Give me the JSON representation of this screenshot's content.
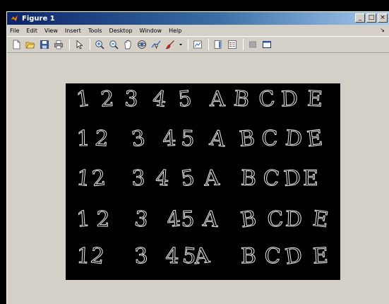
{
  "window": {
    "title": "Figure 1",
    "controls": {
      "minimize": "_",
      "maximize": "□",
      "close": "×"
    }
  },
  "menu": {
    "items": [
      "File",
      "Edit",
      "View",
      "Insert",
      "Tools",
      "Desktop",
      "Window",
      "Help"
    ],
    "end_arrow": "↘"
  },
  "toolbar": {
    "buttons": [
      "new-figure-icon",
      "open-file-icon",
      "save-icon",
      "print-icon",
      "pointer-icon",
      "zoom-in-icon",
      "zoom-out-icon",
      "pan-icon",
      "rotate-3d-icon",
      "data-cursor-icon",
      "brush-icon",
      "link-plot-icon",
      "colorbar-icon",
      "legend-icon",
      "hide-tools-icon",
      "show-tools-icon"
    ]
  },
  "image": {
    "rows": [
      [
        "1",
        "2",
        "3",
        "4",
        "5",
        "A",
        "B",
        "C",
        "D",
        "E"
      ],
      [
        "1",
        "2",
        "3",
        "4",
        "5",
        "A",
        "B",
        "C",
        "D",
        "E"
      ],
      [
        "1",
        "2",
        "3",
        "4",
        "5",
        "A",
        "B",
        "C",
        "D",
        "E"
      ],
      [
        "1",
        "2",
        "3",
        "4",
        "5",
        "A",
        "B",
        "C",
        "D",
        "E"
      ],
      [
        "1",
        "2",
        "3",
        "4",
        "5",
        "A",
        "B",
        "C",
        "D",
        "E"
      ]
    ],
    "stroke_color": "#e6e6e6",
    "background_color": "#000000"
  }
}
